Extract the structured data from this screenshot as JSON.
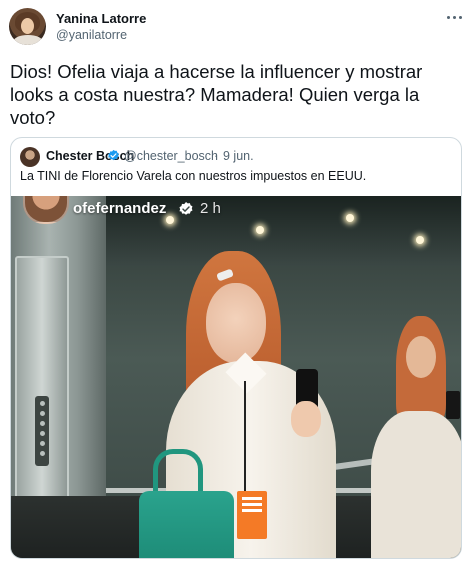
{
  "tweet": {
    "display_name": "Yanina Latorre",
    "handle": "@yanilatorre",
    "text": "Dios! Ofelia viaja a hacerse la influencer y mostrar looks a costa nuestra? Mamadera! Quien verga la voto?",
    "more_icon": "more-horizontal-icon"
  },
  "quote": {
    "display_name": "Chester Bosch",
    "handle": "@chester_bosch",
    "separator": "·",
    "date": "9 jun.",
    "text": "La TINI de Florencio Varela con nuestros impuestos en EEUU.",
    "verified_icon": "verified-badge-icon",
    "verified_color": "#1d9bf0"
  },
  "story_overlay": {
    "username": "ofefernandez",
    "time": "2 h",
    "verified_icon": "verified-badge-icon"
  },
  "colors": {
    "text_primary": "#0f1419",
    "text_secondary": "#536471",
    "border": "#cfd9de",
    "badge_orange": "#f47a26",
    "bag_green": "#1d8b77"
  }
}
